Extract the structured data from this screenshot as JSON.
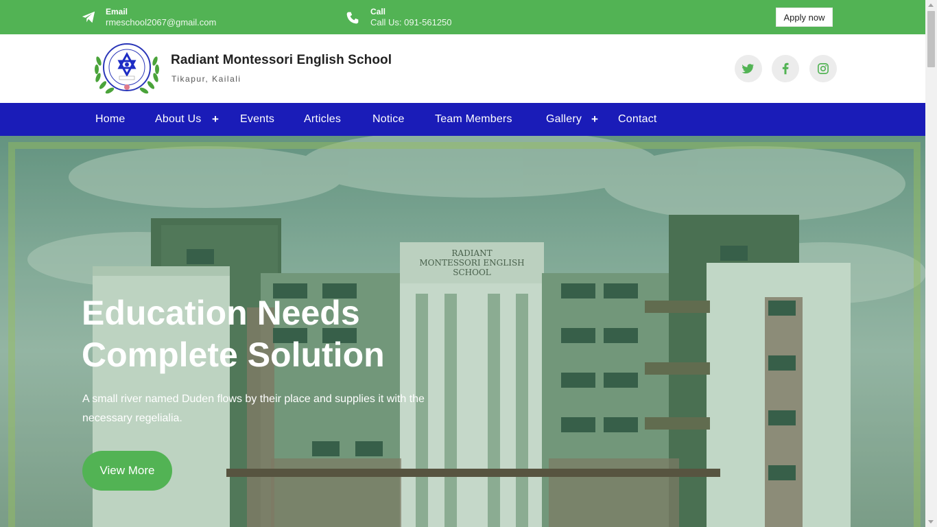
{
  "topbar": {
    "email_title": "Email",
    "email_value": "rmeschool2067@gmail.com",
    "call_title": "Call",
    "call_value": "Call Us: 091-561250",
    "apply_label": "Apply now",
    "email_icon": "paper-plane-icon",
    "call_icon": "phone-icon"
  },
  "header": {
    "school_name": "Radiant Montessori English School",
    "location": "Tikapur, Kailali",
    "logo_text_top": "RADIANT MONTESSORI ENGLISH SCHOOL",
    "logo_text_bottom": "Tikapur, Kailali",
    "logo_est": "ESTD 2067",
    "social": [
      "twitter-icon",
      "facebook-icon",
      "instagram-icon"
    ]
  },
  "nav": {
    "items": [
      {
        "label": "Home"
      },
      {
        "label": "About Us",
        "has_submenu": true
      },
      {
        "label": "Events"
      },
      {
        "label": "Articles"
      },
      {
        "label": "Notice"
      },
      {
        "label": "Team Members"
      },
      {
        "label": "Gallery",
        "has_submenu": true
      },
      {
        "label": "Contact"
      }
    ]
  },
  "hero": {
    "title_line1": "Education Needs",
    "title_line2": "Complete Solution",
    "text": "A small river named Duden flows by their place and supplies it with the necessary regelialia.",
    "button_label": "View More",
    "building_sign": [
      "RADIANT",
      "MONTESSORI ENGLISH",
      "SCHOOL"
    ]
  },
  "colors": {
    "green": "#52b354",
    "nav_blue": "#1a1cb8",
    "white": "#ffffff"
  }
}
